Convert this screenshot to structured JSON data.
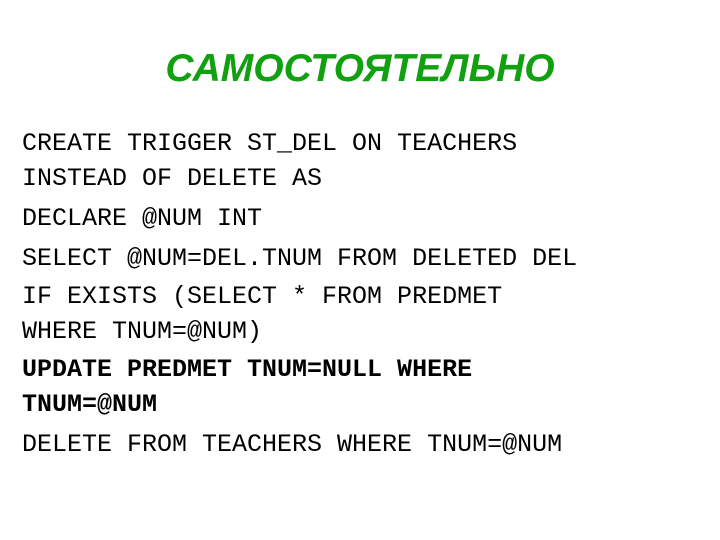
{
  "slide": {
    "title": "САМОСТОЯТЕЛЬНО",
    "title_color": "#10a010",
    "code_lines": [
      {
        "text": "CREATE TRIGGER ST_DEL ON TEACHERS",
        "bold": false
      },
      {
        "text": "INSTEAD OF DELETE AS",
        "bold": false
      },
      {
        "text": "DECLARE @NUM INT",
        "bold": false
      },
      {
        "text": "SELECT @NUM=DEL.TNUM FROM DELETED DEL",
        "bold": false
      },
      {
        "text": "IF EXISTS (SELECT * FROM PREDMET",
        "bold": false
      },
      {
        "text": "WHERE TNUM=@NUM)",
        "bold": false
      },
      {
        "text": "UPDATE PREDMET TNUM=NULL WHERE",
        "bold": true
      },
      {
        "text": "TNUM=@NUM",
        "bold": true
      },
      {
        "text": "DELETE FROM TEACHERS WHERE TNUM=@NUM",
        "bold": false
      }
    ]
  }
}
